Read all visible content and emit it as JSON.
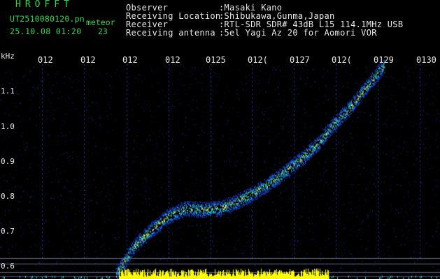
{
  "header": {
    "app_title": "HROFFT",
    "file_name": "UT2510080120.pn",
    "detect_label": "meteor",
    "datetime": "25.10.08 01:20",
    "count": "23"
  },
  "meta": [
    {
      "label": "Observer",
      "value": ":Masaki Kano"
    },
    {
      "label": "Receiving Location",
      "value": ":Shibukawa,Gunma,Japan"
    },
    {
      "label": "Receiver",
      "value": ":RTL-SDR SDR# 43dB L15 114.1MHz USB"
    },
    {
      "label": "Receiving antenna",
      "value": ":5el Yagi Az 20 for Aomori VOR"
    }
  ],
  "time_ticks": [
    "012",
    "012",
    "012",
    "012",
    "0125",
    "012(",
    "0127",
    "012(",
    "0129",
    "0130"
  ],
  "freq_axis": {
    "unit": "kHz",
    "ticks": [
      "1.1",
      "1.0",
      "0.9",
      "0.8",
      "0.7",
      "0.6"
    ]
  },
  "colors": {
    "header_text": "#2fd84a",
    "meta_text": "#e8e8e8",
    "trail_hot": "#ffff40",
    "trail_mid": "#20d0d0",
    "trail_cold": "#2050ff",
    "baseline": "#ffff00"
  }
}
